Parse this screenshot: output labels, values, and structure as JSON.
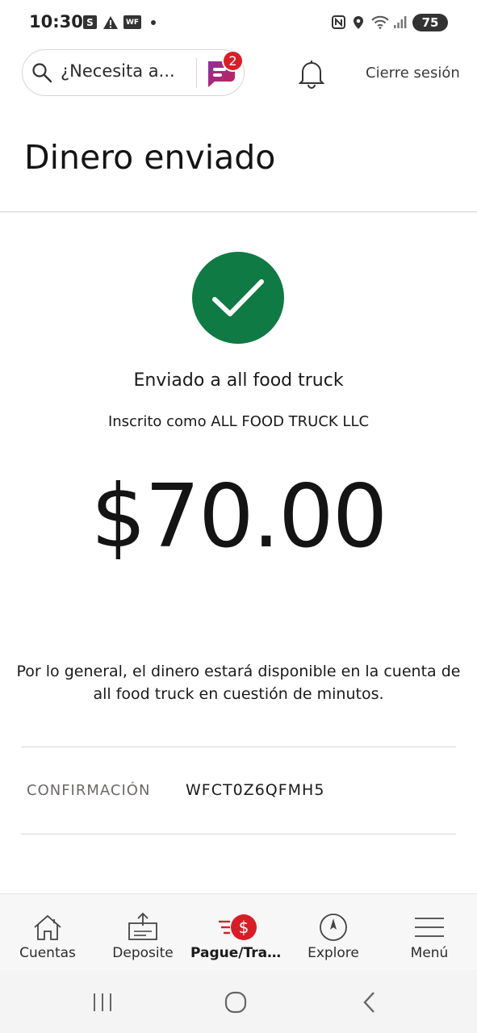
{
  "status_bar": {
    "time": "10:30",
    "notif_s": "S",
    "notif_wf": "WF",
    "battery": "75",
    "icons": [
      "square-s-icon",
      "warning-icon",
      "wf-app-icon",
      "dot-icon",
      "nfc-icon",
      "location-icon",
      "wifi-icon",
      "signal-icon",
      "battery-icon"
    ]
  },
  "header": {
    "search_placeholder": "¿Necesita a...",
    "chat_badge_count": "2",
    "logout_label": "Cierre sesión"
  },
  "page": {
    "title": "Dinero enviado",
    "sent_to": "Enviado a all food truck",
    "enrolled_as": "Inscrito como ALL FOOD TRUCK LLC",
    "amount": "$70.00",
    "note": "Por lo general, el dinero estará disponible en la cuenta de all food truck en cuestión de minutos.",
    "confirmation_label": "CONFIRMACIÓN",
    "confirmation_value": "WFCT0Z6QFMH5"
  },
  "bottom_nav": {
    "items": [
      {
        "label": "Cuentas",
        "icon": "house-icon"
      },
      {
        "label": "Deposite",
        "icon": "deposit-icon"
      },
      {
        "label": "Pague/Tran...",
        "icon": "pay-transfer-icon",
        "active": true
      },
      {
        "label": "Explore",
        "icon": "compass-icon"
      },
      {
        "label": "Menú",
        "icon": "menu-icon"
      }
    ]
  },
  "colors": {
    "success_green": "#0f7a43",
    "brand_red": "#d71e28",
    "chat_purple": "#6b1f7a",
    "text": "#1a1a1a"
  }
}
